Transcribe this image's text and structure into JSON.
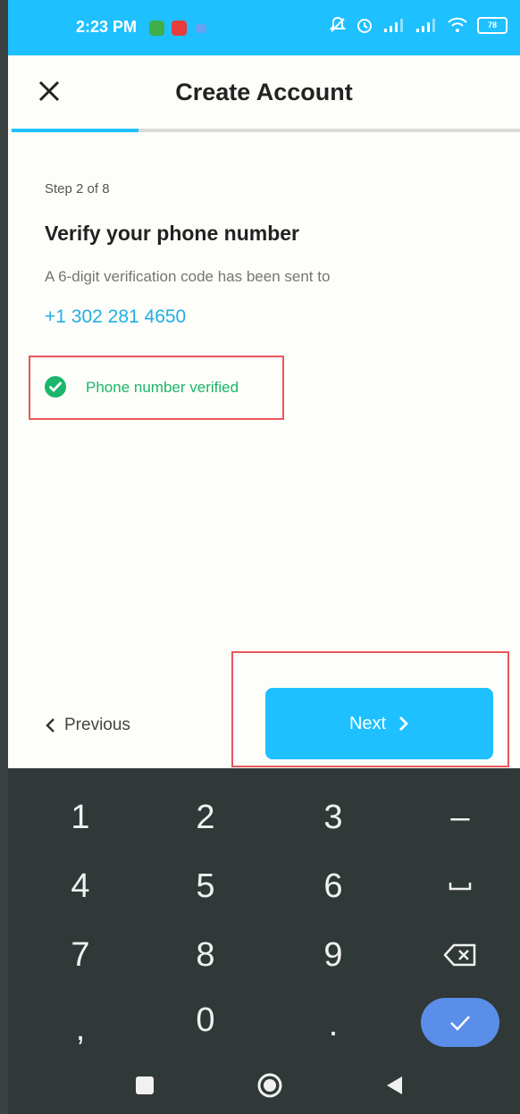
{
  "status_bar": {
    "time": "2:23 PM",
    "battery": "78",
    "bg_color": "#1ec0ff"
  },
  "header": {
    "title": "Create Account",
    "close_icon": "close-icon"
  },
  "progress": {
    "current_step": 2,
    "total_steps": 8,
    "fraction": 0.25
  },
  "content": {
    "step_label": "Step 2 of 8",
    "heading": "Verify your phone number",
    "subtext": "A 6-digit verification code has been sent to",
    "phone": "+1 302 281 4650",
    "verified_text": "Phone number verified"
  },
  "nav": {
    "previous_label": "Previous",
    "next_label": "Next"
  },
  "keyboard": {
    "keys": [
      "1",
      "2",
      "3",
      "–",
      "4",
      "5",
      "6",
      "␣",
      "7",
      "8",
      "9",
      "⌫",
      ",",
      "0",
      ".",
      "✓"
    ]
  },
  "colors": {
    "accent": "#1ec0ff",
    "success": "#1bb56b",
    "highlight_border": "#e8585a",
    "keyboard_bg": "#303838"
  }
}
